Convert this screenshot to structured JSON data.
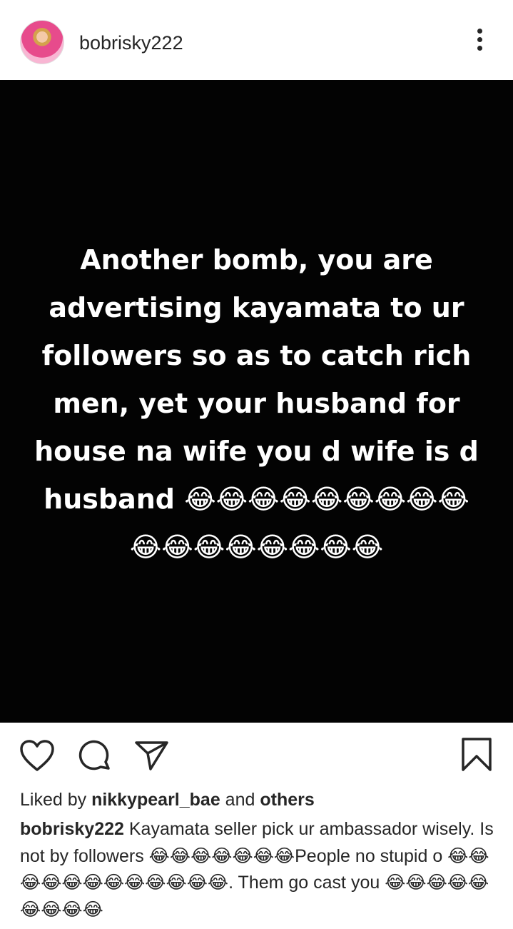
{
  "post_header": {
    "username": "bobrisky222"
  },
  "post": {
    "image_text": "Another bomb, you are advertising kayamata to ur followers so as to catch rich men, yet your husband for house na wife you d wife is d husband 😂😂😂😂😂😂😂😂😂😂😂😂😂😂😂😂😂",
    "background_color": "#030303"
  },
  "actions": {
    "icons": [
      "heart-icon",
      "comment-icon",
      "share-icon",
      "bookmark-icon"
    ]
  },
  "likes": {
    "prefix": "Liked by ",
    "user": "nikkypearl_bae",
    "middle": " and ",
    "others": "others"
  },
  "caption": {
    "user": "bobrisky222",
    "text": " Kayamata seller pick ur ambassador wisely. Is not by followers 😂😂😂😂😂😂😂People no stupid o 😂😂😂😂😂😂😂😂😂😂😂😂. Them go cast you 😂😂😂😂😂😂😂😂😂"
  }
}
